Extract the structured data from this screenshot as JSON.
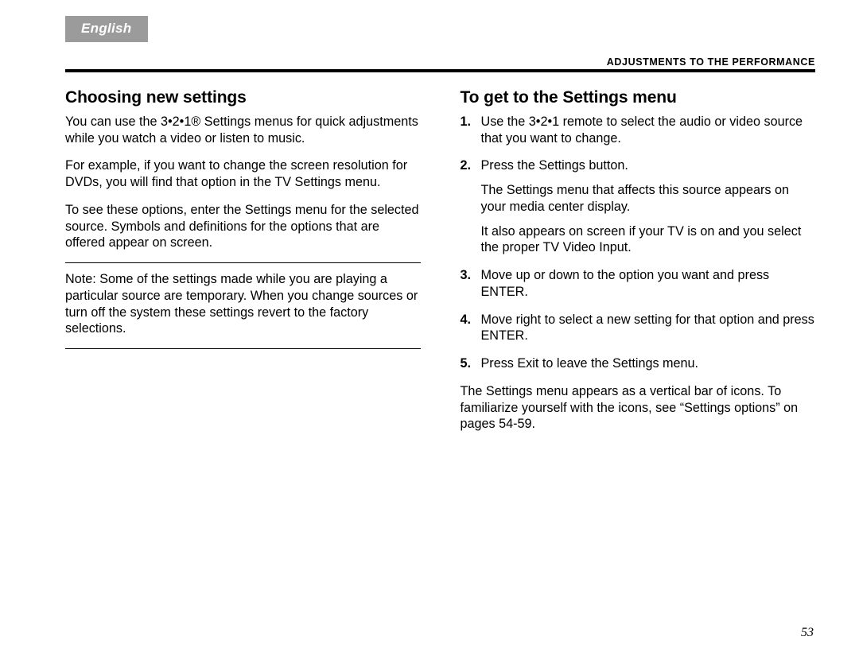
{
  "lang_tab": "English",
  "section_label": "Adjustments to the performance",
  "page_number": "53",
  "left": {
    "heading": "Choosing new settings",
    "p1": "You can use the 3•2•1® Settings menus for quick adjustments while you watch a video or listen to music.",
    "p2": "For example, if you want to change the screen resolution for DVDs, you will find that option in the TV Settings menu.",
    "p3": "To see these options, enter the Settings menu for the selected source. Symbols and definitions for the options that are offered appear on screen.",
    "note": "Note:  Some of the settings made while you are playing a particular source are temporary. When you change sources or turn off the system these settings revert to the factory selections."
  },
  "right": {
    "heading": "To get to the Settings menu",
    "steps": [
      {
        "n": "1.",
        "text": "Use the 3•2•1 remote to select the audio or video source that you want to change."
      },
      {
        "n": "2.",
        "text": "Press the Settings button.",
        "sub1": "The Settings menu that affects this source appears on your media center display.",
        "sub2": "It also appears on screen if your TV is on and you select the proper TV Video Input."
      },
      {
        "n": "3.",
        "text": "Move up or down to the option you want and press ENTER."
      },
      {
        "n": "4.",
        "text": "Move right to select a new setting for that option and press ENTER."
      },
      {
        "n": "5.",
        "text": "Press Exit to leave the Settings menu."
      }
    ],
    "after": "The Settings menu appears as a vertical bar of icons. To familiarize yourself with the icons, see “Settings options” on pages 54-59."
  }
}
